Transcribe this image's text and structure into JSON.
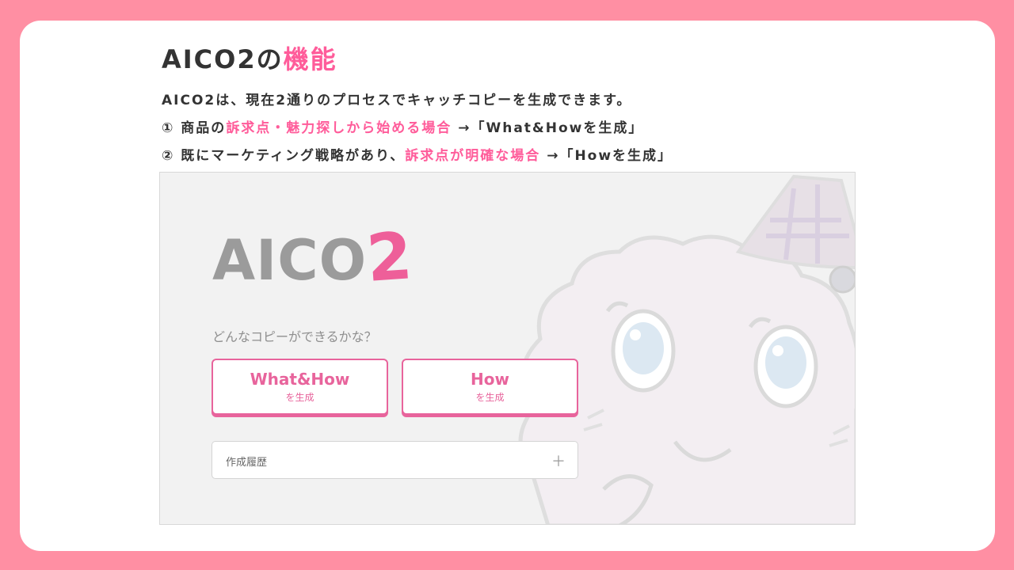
{
  "heading": {
    "prefix": "AICO2の",
    "highlight": "機能"
  },
  "description": {
    "intro": "AICO2は、現在2通りのプロセスでキャッチコピーを生成できます。",
    "item1": {
      "prefix": "① 商品の",
      "highlight": "訴求点・魅力探しから始める場合",
      "suffix": " →「What&Howを生成」"
    },
    "item2": {
      "prefix": "② 既にマーケティング戦略があり、",
      "highlight": "訴求点が明確な場合",
      "suffix": " →「Howを生成」"
    }
  },
  "app": {
    "logo": {
      "text": "AICO",
      "number": "2"
    },
    "question": "どんなコピーができるかな？",
    "buttons": [
      {
        "label": "What&How",
        "sub": "を生成"
      },
      {
        "label": "How",
        "sub": "を生成"
      }
    ],
    "history": {
      "label": "作成履歴",
      "icon": "plus-icon"
    }
  },
  "colors": {
    "frame": "#ff8fa3",
    "accent": "#ff5c9a",
    "button": "#e8649c",
    "logo_gray": "#9b9b9b"
  }
}
